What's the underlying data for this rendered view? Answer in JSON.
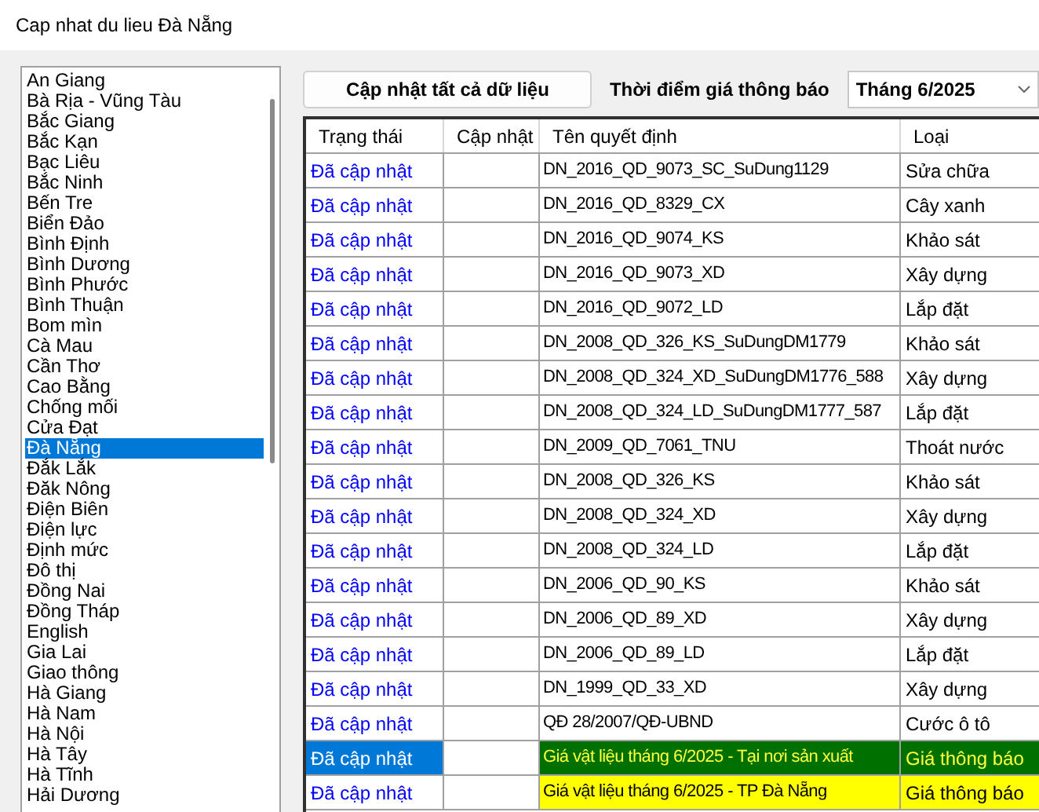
{
  "window": {
    "title": "Cap nhat du lieu Đà Nẵng"
  },
  "provinces": [
    {
      "label": "An Giang",
      "selected": false
    },
    {
      "label": "Bà Rịa - Vũng Tàu",
      "selected": false
    },
    {
      "label": "Bắc Giang",
      "selected": false
    },
    {
      "label": "Bắc Kạn",
      "selected": false
    },
    {
      "label": "Bạc Liêu",
      "selected": false
    },
    {
      "label": "Bắc Ninh",
      "selected": false
    },
    {
      "label": "Bến Tre",
      "selected": false
    },
    {
      "label": "Biển Đảo",
      "selected": false
    },
    {
      "label": "Bình Định",
      "selected": false
    },
    {
      "label": "Bình Dương",
      "selected": false
    },
    {
      "label": "Bình Phước",
      "selected": false
    },
    {
      "label": "Bình Thuận",
      "selected": false
    },
    {
      "label": "Bom mìn",
      "selected": false
    },
    {
      "label": "Cà Mau",
      "selected": false
    },
    {
      "label": "Cần Thơ",
      "selected": false
    },
    {
      "label": "Cao Bằng",
      "selected": false
    },
    {
      "label": "Chống mối",
      "selected": false
    },
    {
      "label": "Cửa Đạt",
      "selected": false
    },
    {
      "label": "Đà Nẵng",
      "selected": true
    },
    {
      "label": "Đắk Lắk",
      "selected": false
    },
    {
      "label": "Đăk Nông",
      "selected": false
    },
    {
      "label": "Điện Biên",
      "selected": false
    },
    {
      "label": "Điện lực",
      "selected": false
    },
    {
      "label": "Định mức",
      "selected": false
    },
    {
      "label": "Đô thị",
      "selected": false
    },
    {
      "label": "Đồng Nai",
      "selected": false
    },
    {
      "label": "Đồng Tháp",
      "selected": false
    },
    {
      "label": "English",
      "selected": false
    },
    {
      "label": "Gia Lai",
      "selected": false
    },
    {
      "label": "Giao thông",
      "selected": false
    },
    {
      "label": "Hà Giang",
      "selected": false
    },
    {
      "label": "Hà Nam",
      "selected": false
    },
    {
      "label": "Hà Nội",
      "selected": false
    },
    {
      "label": "Hà Tây",
      "selected": false
    },
    {
      "label": "Hà Tĩnh",
      "selected": false
    },
    {
      "label": "Hải Dương",
      "selected": false
    }
  ],
  "update_all_button": "Cập nhật tất cả dữ liệu",
  "period": {
    "label": "Thời điểm giá thông báo",
    "value": "Tháng 6/2025"
  },
  "table": {
    "columns": [
      "Trạng thái",
      "Cập nhật",
      "Tên quyết định",
      "Loại"
    ],
    "rows": [
      {
        "status": "Đã cập nhật",
        "name": "DN_2016_QD_9073_SC_SuDung1129",
        "type": "Sửa chữa",
        "selected": false,
        "highlighted": false
      },
      {
        "status": "Đã cập nhật",
        "name": "DN_2016_QD_8329_CX",
        "type": "Cây xanh",
        "selected": false,
        "highlighted": false
      },
      {
        "status": "Đã cập nhật",
        "name": "DN_2016_QD_9074_KS",
        "type": "Khảo sát",
        "selected": false,
        "highlighted": false
      },
      {
        "status": "Đã cập nhật",
        "name": "DN_2016_QD_9073_XD",
        "type": "Xây dựng",
        "selected": false,
        "highlighted": false
      },
      {
        "status": "Đã cập nhật",
        "name": "DN_2016_QD_9072_LD",
        "type": "Lắp đặt",
        "selected": false,
        "highlighted": false
      },
      {
        "status": "Đã cập nhật",
        "name": "DN_2008_QD_326_KS_SuDungDM1779",
        "type": "Khảo sát",
        "selected": false,
        "highlighted": false
      },
      {
        "status": "Đã cập nhật",
        "name": "DN_2008_QD_324_XD_SuDungDM1776_588",
        "type": "Xây dựng",
        "selected": false,
        "highlighted": false
      },
      {
        "status": "Đã cập nhật",
        "name": "DN_2008_QD_324_LD_SuDungDM1777_587",
        "type": "Lắp đặt",
        "selected": false,
        "highlighted": false
      },
      {
        "status": "Đã cập nhật",
        "name": "DN_2009_QD_7061_TNU",
        "type": "Thoát nước",
        "selected": false,
        "highlighted": false
      },
      {
        "status": "Đã cập nhật",
        "name": "DN_2008_QD_326_KS",
        "type": "Khảo sát",
        "selected": false,
        "highlighted": false
      },
      {
        "status": "Đã cập nhật",
        "name": "DN_2008_QD_324_XD",
        "type": "Xây dựng",
        "selected": false,
        "highlighted": false
      },
      {
        "status": "Đã cập nhật",
        "name": "DN_2008_QD_324_LD",
        "type": "Lắp đặt",
        "selected": false,
        "highlighted": false
      },
      {
        "status": "Đã cập nhật",
        "name": "DN_2006_QD_90_KS",
        "type": "Khảo sát",
        "selected": false,
        "highlighted": false
      },
      {
        "status": "Đã cập nhật",
        "name": "DN_2006_QD_89_XD",
        "type": "Xây dựng",
        "selected": false,
        "highlighted": false
      },
      {
        "status": "Đã cập nhật",
        "name": "DN_2006_QD_89_LD",
        "type": "Lắp đặt",
        "selected": false,
        "highlighted": false
      },
      {
        "status": "Đã cập nhật",
        "name": "DN_1999_QD_33_XD",
        "type": "Xây dựng",
        "selected": false,
        "highlighted": false
      },
      {
        "status": "Đã cập nhật",
        "name": "QĐ 28/2007/QĐ-UBND",
        "type": "Cước ô tô",
        "selected": false,
        "highlighted": false
      },
      {
        "status": "Đã cập nhật",
        "name": "Giá vật liệu tháng 6/2025 - Tại nơi sản xuất",
        "type": "Giá thông báo",
        "selected": true,
        "highlighted": true
      },
      {
        "status": "Đã cập nhật",
        "name": "Giá vật liệu tháng 6/2025 - TP Đà Nẵng",
        "type": "Giá thông báo",
        "selected": false,
        "highlighted": true
      }
    ]
  }
}
